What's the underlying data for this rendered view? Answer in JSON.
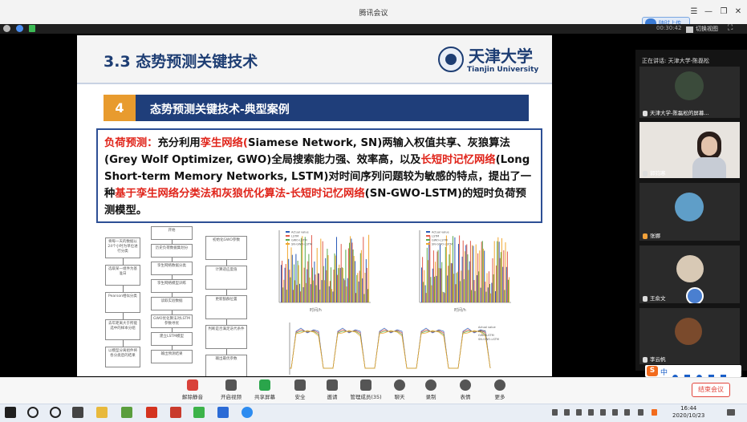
{
  "window": {
    "title": "腾讯会议",
    "upload_label": "随时上传",
    "switch_view_label": "切换视图",
    "timer": "00:30:42"
  },
  "slide": {
    "heading": "3.3 态势预测关键技术",
    "university_cn": "天津大学",
    "university_en": "Tianjin University",
    "section_number": "4",
    "section_title": "态势预测关键技术-典型案例",
    "paragraph_parts": [
      {
        "text": "负荷预测：",
        "color": "red"
      },
      {
        "text": "充分利用",
        "color": "black"
      },
      {
        "text": "孪生网络(",
        "color": "red"
      },
      {
        "text": "Siamese Network, SN)两输入权值共享、灰狼算法(Grey Wolf Optimizer, GWO)全局搜索能力强、效率高，以及",
        "color": "black"
      },
      {
        "text": "长短时记忆网络",
        "color": "red"
      },
      {
        "text": "(Long Short-term Memory Networks, LSTM)对时间序列问题较为敏感的特点，提出了一种",
        "color": "black"
      },
      {
        "text": "基于孪生网络分类法和灰狼优化算法-长短时记忆网络",
        "color": "red"
      },
      {
        "text": "(SN-GWO-LSTM)的短时负荷预测模型。",
        "color": "black"
      }
    ],
    "flowchart_left": [
      "将每一天的数据以24个小时为单位进行分类",
      "选取某一组件为基准日",
      "Pearson相似分类",
      "去年距离大于所能选中的样本分组",
      "以模型分离组件将各分类后的结果"
    ],
    "flowchart_middle": [
      "开始",
      "历史负荷数据集划分",
      "孪生网络数据分类",
      "孪生网络模型训练",
      "读取实验数据",
      "GWO优化算法对LSTM参数寻优",
      "建立LSTM模型",
      "输出预测结果"
    ],
    "flowchart_right": [
      "初始化GWO参数",
      "计算适应度值",
      "更新狼群位置",
      "判断是否满足迭代条件",
      "输出最优参数"
    ],
    "chart_legend": [
      "Actual value",
      "LSTM",
      "GWO-LSTM",
      "SN-GWO-LSTM"
    ],
    "chart1_xlabel": "时间/h",
    "chart2_xlabel": "时间/h"
  },
  "participants": {
    "speaking": "正在讲话: 天津大学-陈磊松",
    "tiles": [
      {
        "name": "天津大学-陈磊松的屏幕..."
      },
      {
        "name": "郭钧寒"
      },
      {
        "name": "张娜"
      },
      {
        "name": "王俞文"
      },
      {
        "name": "李云帆"
      }
    ]
  },
  "toolbar": {
    "items": [
      {
        "label": "解除静音",
        "icon": "mic-muted-icon"
      },
      {
        "label": "开启视频",
        "icon": "camera-off-icon"
      },
      {
        "label": "共享屏幕",
        "icon": "share-screen-icon"
      },
      {
        "label": "安全",
        "icon": "shield-icon"
      },
      {
        "label": "邀请",
        "icon": "invite-icon"
      },
      {
        "label": "管理成员(35)",
        "icon": "members-icon"
      },
      {
        "label": "聊天",
        "icon": "chat-icon"
      },
      {
        "label": "录制",
        "icon": "record-icon"
      },
      {
        "label": "表情",
        "icon": "emoji-icon"
      },
      {
        "label": "更多",
        "icon": "more-icon"
      }
    ],
    "end_label": "结束会议"
  },
  "taskbar": {
    "time": "16:44",
    "date": "2020/10/23"
  },
  "ime": {
    "label": "中"
  }
}
